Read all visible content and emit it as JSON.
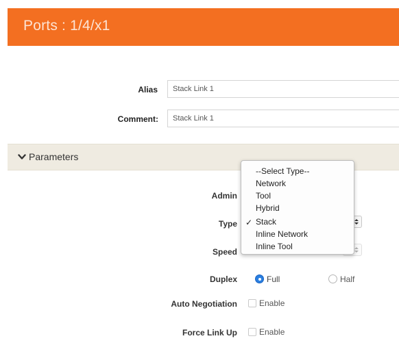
{
  "header": {
    "title": "Ports : 1/4/x1",
    "color": "#f36f21"
  },
  "form": {
    "alias_label": "Alias",
    "alias_value": "Stack Link 1",
    "comment_label": "Comment:",
    "comment_value": "Stack Link 1"
  },
  "parameters": {
    "section_label": "Parameters",
    "admin_label": "Admin",
    "type_label": "Type",
    "speed_label": "Speed",
    "duplex_label": "Duplex",
    "duplex_options": [
      {
        "label": "Full",
        "selected": true
      },
      {
        "label": "Half",
        "selected": false
      }
    ],
    "auto_negotiation_label": "Auto Negotiation",
    "auto_negotiation_option": "Enable",
    "force_link_up_label": "Force Link Up",
    "force_link_up_option": "Enable"
  },
  "type_dropdown": {
    "options": [
      "--Select Type--",
      "Network",
      "Tool",
      "Hybrid",
      "Stack",
      "Inline Network",
      "Inline Tool"
    ],
    "selected": "Stack",
    "check_mark": "✓"
  }
}
